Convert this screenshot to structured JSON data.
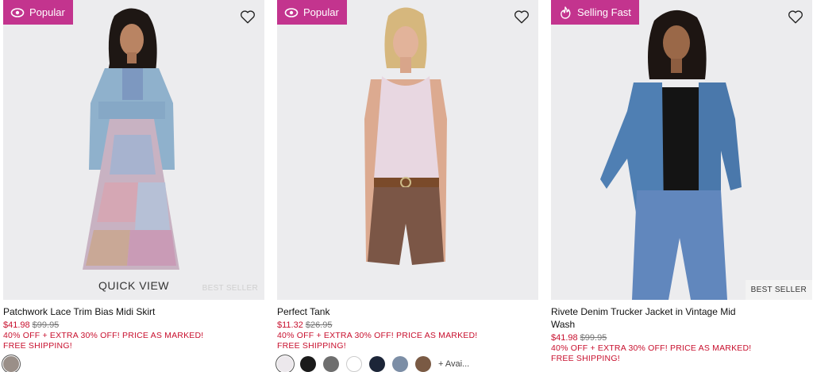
{
  "products": [
    {
      "badge": "Popular",
      "badge_icon": "eye-icon",
      "name": "Patchwork Lace Trim Bias Midi Skirt",
      "sale_price": "$41.98",
      "original_price": "$99.95",
      "promo": "40% OFF + EXTRA 30% OFF! PRICE AS MARKED!",
      "shipping": "FREE SHIPPING!",
      "quick_view": "QUICK VIEW",
      "best_seller": "BEST SELLER",
      "swatches": [
        "#9a8f88"
      ]
    },
    {
      "badge": "Popular",
      "badge_icon": "eye-icon",
      "name": "Perfect Tank",
      "sale_price": "$11.32",
      "original_price": "$26.95",
      "promo": "40% OFF + EXTRA 30% OFF! PRICE AS MARKED!",
      "shipping": "FREE SHIPPING!",
      "swatches": [
        "#ece8ec",
        "#1a1a1a",
        "#6e6e6e",
        "#ffffff",
        "#1c2538",
        "#7c8ea6",
        "#7a5a44"
      ],
      "more_colors": "+ Avai..."
    },
    {
      "badge": "Selling Fast",
      "badge_icon": "flame-icon",
      "name": "Rivete Denim Trucker Jacket in Vintage Mid Wash",
      "sale_price": "$41.98",
      "original_price": "$99.95",
      "promo": "40% OFF + EXTRA 30% OFF! PRICE AS MARKED!",
      "shipping": "FREE SHIPPING!",
      "best_seller": "BEST SELLER"
    }
  ],
  "colors": {
    "badge": "#c3348e",
    "sale": "#c8102e"
  }
}
